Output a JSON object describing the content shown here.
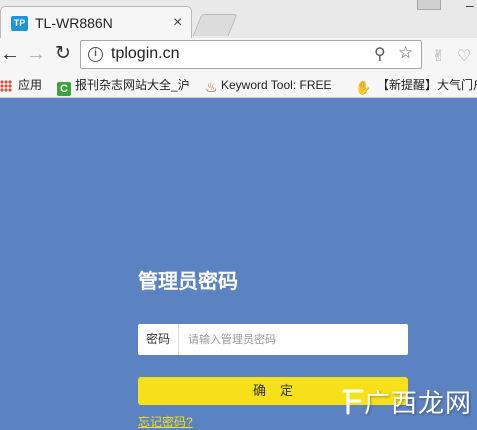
{
  "browser": {
    "tab_title": "TL-WR886N",
    "tab_favicon_text": "TP",
    "tab_close": "×",
    "url": "tplogin.cn"
  },
  "bookmarks": [
    {
      "label": "应用",
      "icon": "apps-grid-icon"
    },
    {
      "label": "报刊杂志网站大全_沪",
      "icon": "c-badge-icon"
    },
    {
      "label": "Keyword Tool: FREE",
      "icon": "flame-icon"
    },
    {
      "label": "【新提醒】大气门户",
      "icon": "thumbs-up-icon"
    }
  ],
  "login": {
    "title": "管理员密码",
    "password_label": "密码",
    "password_placeholder": "请输入管理员密码",
    "confirm_button": "确定",
    "forgot_link": "忘记密码?"
  },
  "watermark": {
    "text": "广西龙网"
  },
  "colors": {
    "page_background": "#5b83c2",
    "button_yellow": "#f5e01a",
    "link_yellow": "#f5e01a"
  }
}
